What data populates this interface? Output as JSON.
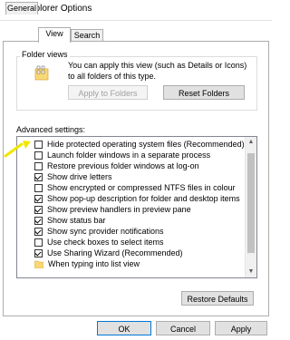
{
  "window": {
    "title": "File Explorer Options"
  },
  "tabs": [
    {
      "label": "General"
    },
    {
      "label": "View"
    },
    {
      "label": "Search"
    }
  ],
  "folder_views": {
    "label": "Folder views",
    "description": "You can apply this view (such as Details or Icons) to all folders of this type.",
    "apply_button": "Apply to Folders",
    "reset_button": "Reset Folders"
  },
  "advanced": {
    "label": "Advanced settings:",
    "items": [
      {
        "label": "Hide protected operating system files (Recommended)",
        "checked": false
      },
      {
        "label": "Launch folder windows in a separate process",
        "checked": false
      },
      {
        "label": "Restore previous folder windows at log-on",
        "checked": false
      },
      {
        "label": "Show drive letters",
        "checked": true
      },
      {
        "label": "Show encrypted or compressed NTFS files in colour",
        "checked": false
      },
      {
        "label": "Show pop-up description for folder and desktop items",
        "checked": true
      },
      {
        "label": "Show preview handlers in preview pane",
        "checked": true
      },
      {
        "label": "Show status bar",
        "checked": true
      },
      {
        "label": "Show sync provider notifications",
        "checked": true
      },
      {
        "label": "Use check boxes to select items",
        "checked": false
      },
      {
        "label": "Use Sharing Wizard (Recommended)",
        "checked": true
      },
      {
        "label": "When typing into list view",
        "type": "folder"
      }
    ],
    "restore_button": "Restore Defaults"
  },
  "footer": {
    "ok": "OK",
    "cancel": "Cancel",
    "apply": "Apply"
  },
  "colors": {
    "accent": "#0078d7",
    "arrow": "#f2e600"
  }
}
